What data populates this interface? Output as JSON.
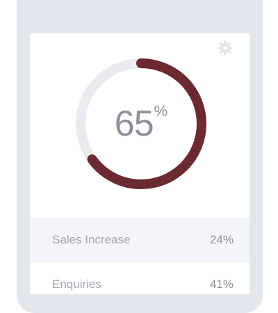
{
  "gauge": {
    "value": 65,
    "unit": "%",
    "fraction": 0.65,
    "track_color": "#e9ebf0",
    "fill_color": "#6b2a30"
  },
  "header": {
    "settings_icon": "gear-icon"
  },
  "stats": [
    {
      "label": "Sales Increase",
      "value": "24%"
    },
    {
      "label": "Enquiries",
      "value": "41%"
    }
  ]
}
